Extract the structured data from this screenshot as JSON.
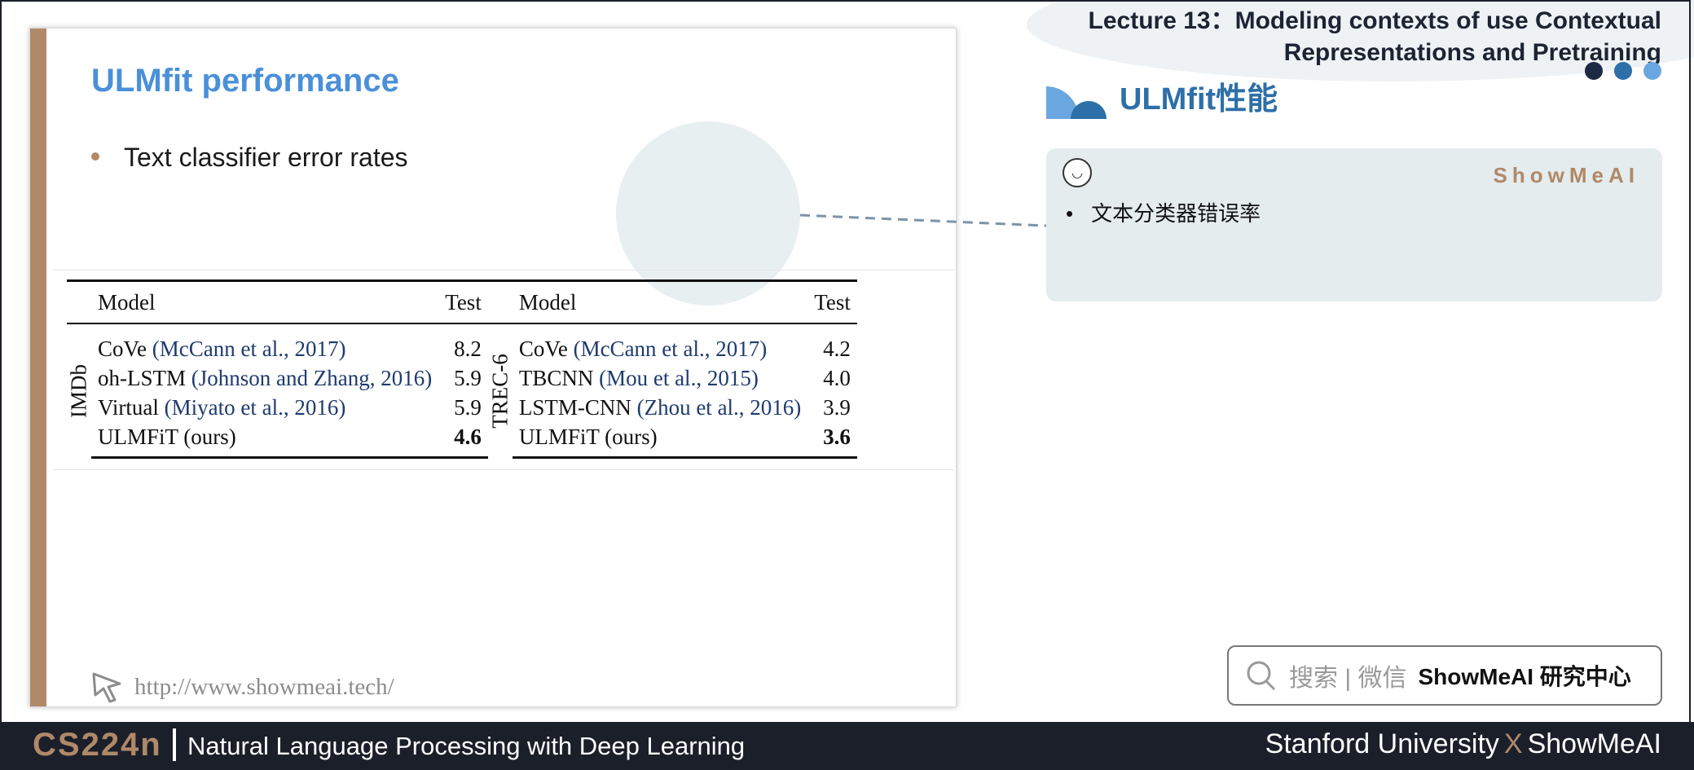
{
  "header": {
    "lecture_title": "Lecture 13：Modeling contexts of use Contextual Representations and Pretraining",
    "dot_colors": [
      "#1c2a44",
      "#2d6fa8",
      "#6aa7e0"
    ]
  },
  "slide": {
    "title": "ULMfit performance",
    "bullet": "Text classifier error rates",
    "table": {
      "header": {
        "model": "Model",
        "test": "Test"
      },
      "groups": [
        {
          "label": "IMDb",
          "rows": [
            {
              "model": "CoVe",
              "cite": "(McCann et al., 2017)",
              "test": "8.2"
            },
            {
              "model": "oh-LSTM",
              "cite": "(Johnson and Zhang, 2016)",
              "test": "5.9"
            },
            {
              "model": "Virtual",
              "cite": "(Miyato et al., 2016)",
              "test": "5.9"
            },
            {
              "model": "ULMFiT (ours)",
              "cite": "",
              "test": "4.6"
            }
          ]
        },
        {
          "label": "TREC-6",
          "rows": [
            {
              "model": "CoVe",
              "cite": "(McCann et al., 2017)",
              "test": "4.2"
            },
            {
              "model": "TBCNN",
              "cite": "(Mou et al., 2015)",
              "test": "4.0"
            },
            {
              "model": "LSTM-CNN",
              "cite": "(Zhou et al., 2016)",
              "test": "3.9"
            },
            {
              "model": "ULMFiT (ours)",
              "cite": "",
              "test": "3.6"
            }
          ]
        }
      ]
    },
    "url": "http://www.showmeai.tech/"
  },
  "panel": {
    "title": "ULMfit性能",
    "brand": "ShowMeAI",
    "bullet": "文本分类器错误率",
    "search_placeholder": "搜索 | 微信",
    "search_brand": "ShowMeAI 研究中心"
  },
  "footer": {
    "course": "CS224n",
    "course_desc": "Natural Language Processing with Deep Learning",
    "uni": "Stanford University",
    "x": "X",
    "partner": "ShowMeAI"
  },
  "colors": {
    "accent": "#b08968",
    "title_blue": "#4a90d9",
    "dark": "#1b1f2a"
  }
}
